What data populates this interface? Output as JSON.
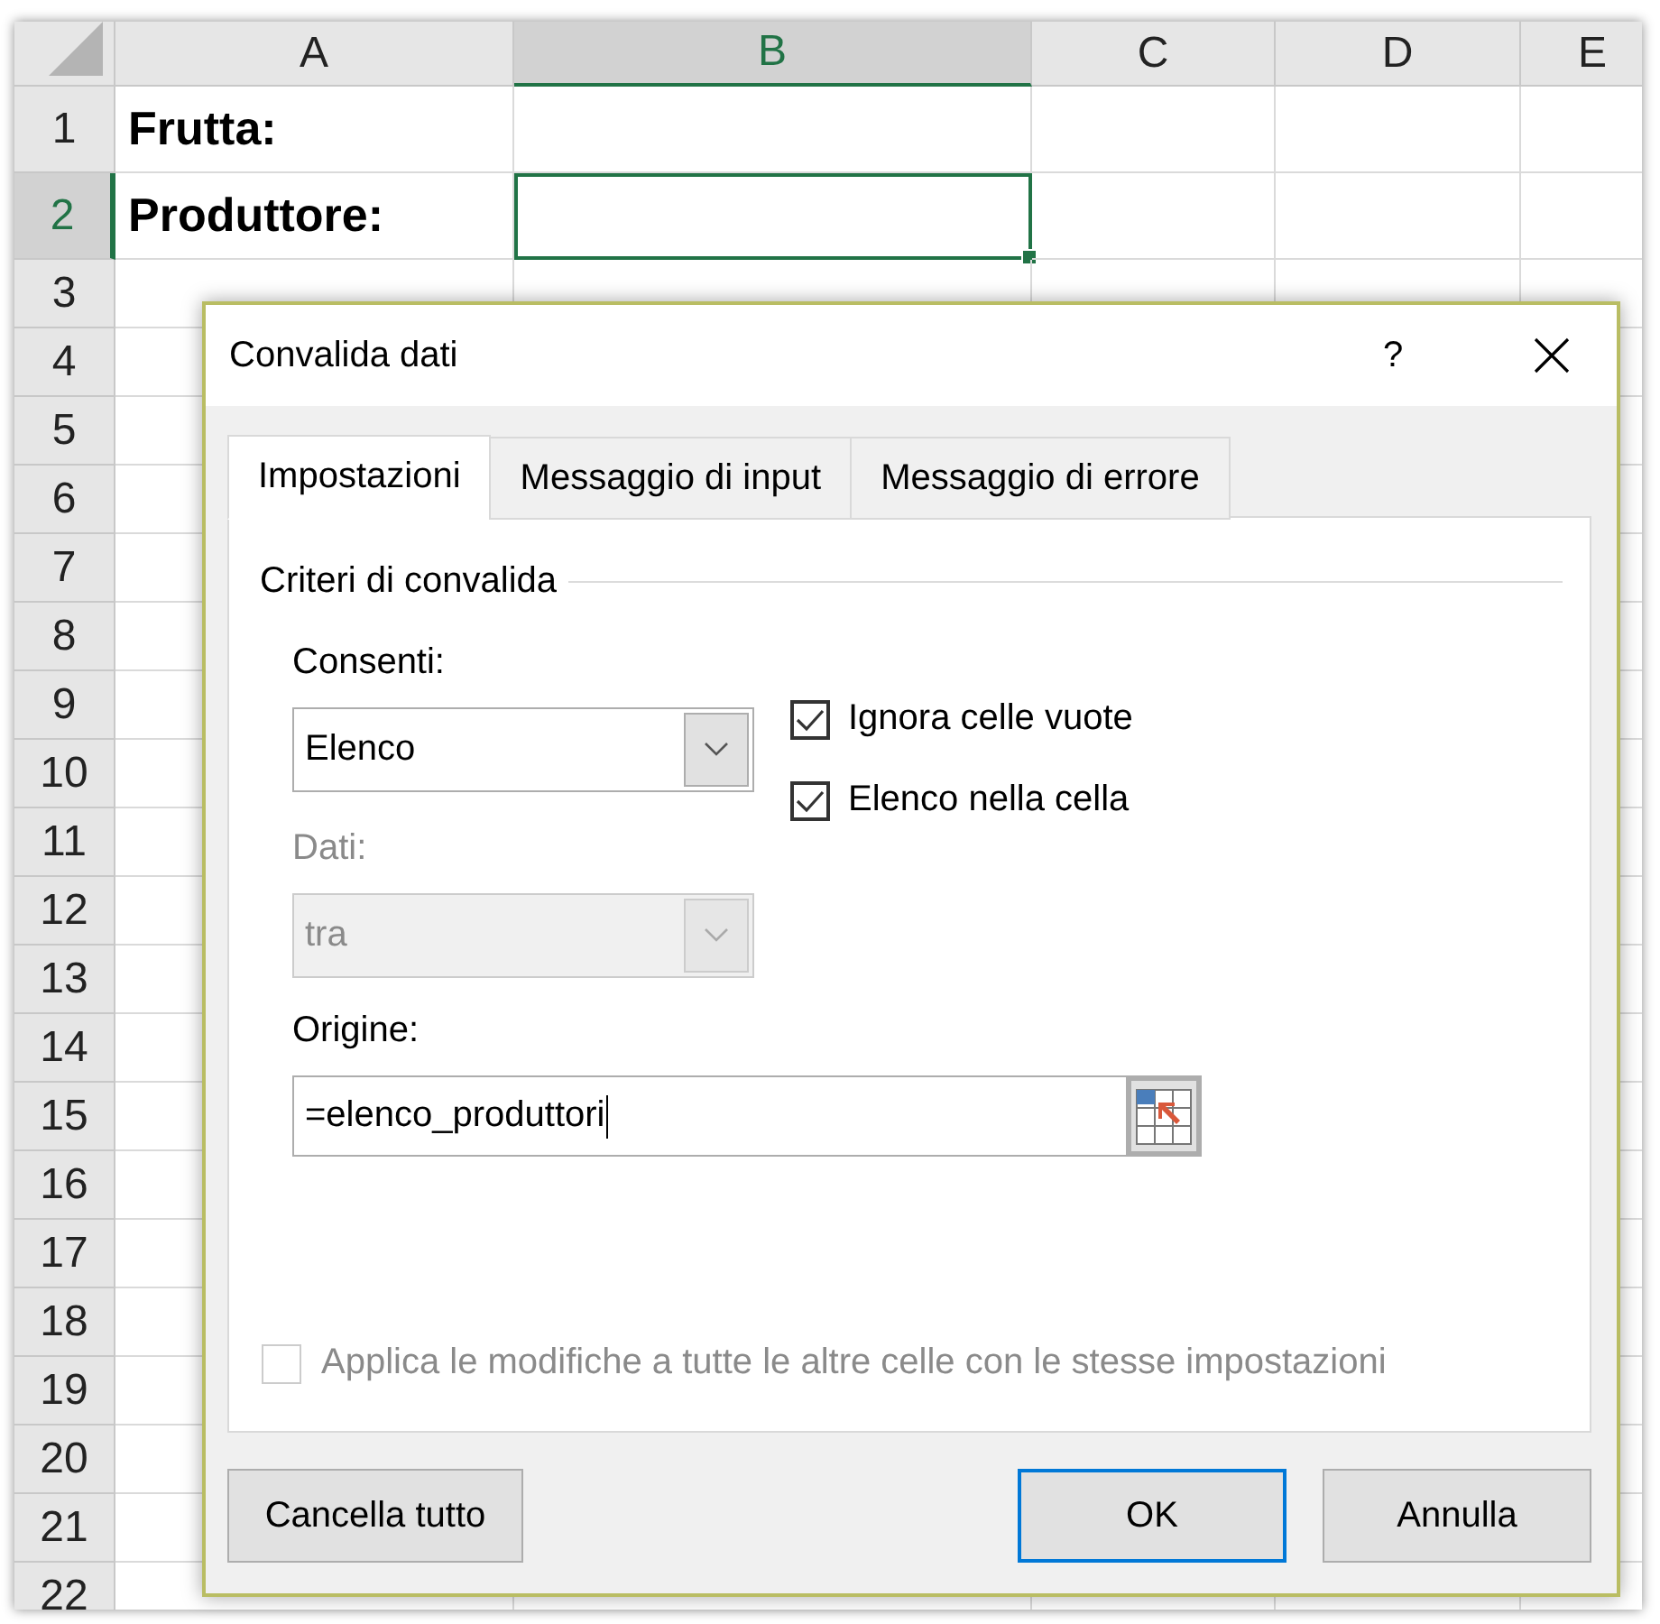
{
  "sheet": {
    "columns": [
      {
        "label": "A",
        "selected": false
      },
      {
        "label": "B",
        "selected": true
      },
      {
        "label": "C",
        "selected": false
      },
      {
        "label": "D",
        "selected": false
      },
      {
        "label": "E",
        "selected": false
      }
    ],
    "rows": [
      {
        "number": "1",
        "selected": false,
        "cells": [
          {
            "text": "Frutta:",
            "selected": false
          }
        ]
      },
      {
        "number": "2",
        "selected": true,
        "cells": [
          {
            "text": "Produttore:",
            "selected": false
          },
          {
            "selected": true
          }
        ]
      },
      {
        "number": "3",
        "selected": false
      },
      {
        "number": "4",
        "selected": false
      },
      {
        "number": "5",
        "selected": false
      },
      {
        "number": "6",
        "selected": false
      },
      {
        "number": "7",
        "selected": false
      },
      {
        "number": "8",
        "selected": false
      },
      {
        "number": "9",
        "selected": false
      },
      {
        "number": "10",
        "selected": false
      },
      {
        "number": "11",
        "selected": false
      },
      {
        "number": "12",
        "selected": false
      },
      {
        "number": "13",
        "selected": false
      },
      {
        "number": "14",
        "selected": false
      },
      {
        "number": "15",
        "selected": false
      },
      {
        "number": "16",
        "selected": false
      },
      {
        "number": "17",
        "selected": false
      },
      {
        "number": "18",
        "selected": false
      },
      {
        "number": "19",
        "selected": false
      },
      {
        "number": "20",
        "selected": false
      },
      {
        "number": "21",
        "selected": false
      },
      {
        "number": "22",
        "selected": false
      }
    ]
  },
  "dialog": {
    "title": "Convalida dati",
    "help": "?",
    "tabs": [
      {
        "label": "Impostazioni",
        "selected": true
      },
      {
        "label": "Messaggio di input",
        "selected": false
      },
      {
        "label": "Messaggio di errore",
        "selected": false
      }
    ],
    "group_title": "Criteri di convalida",
    "allow": {
      "label": "Consenti:",
      "value": "Elenco",
      "disabled": false
    },
    "data": {
      "label": "Dati:",
      "value": "tra",
      "disabled": true
    },
    "options": [
      {
        "label": "Ignora celle vuote",
        "checked": true
      },
      {
        "label": "Elenco nella cella",
        "checked": true
      }
    ],
    "source": {
      "label": "Origine:",
      "value": "=elenco_produttori"
    },
    "apply_all": {
      "label": "Applica le modifiche a tutte le altre celle con le stesse impostazioni",
      "checked": false,
      "disabled": true
    },
    "buttons": [
      {
        "label": "Cancella tutto",
        "default": false
      },
      {
        "label": "OK",
        "default": true
      },
      {
        "label": "Annulla",
        "default": false
      }
    ]
  }
}
